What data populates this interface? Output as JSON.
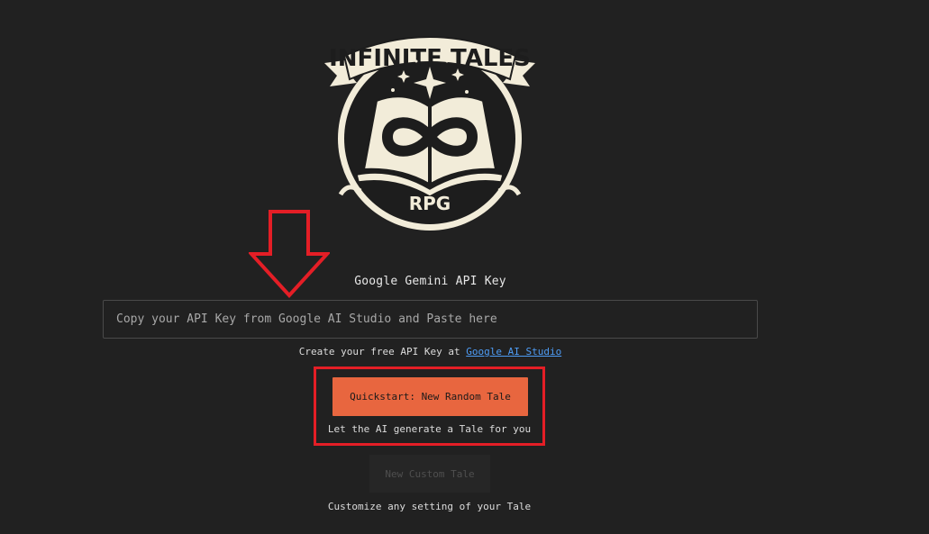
{
  "logo": {
    "title": "INFINITE TALES",
    "subtitle": "RPG"
  },
  "api_key": {
    "label": "Google Gemini API Key",
    "placeholder": "Copy your API Key from Google AI Studio and Paste here",
    "value": "",
    "help_prefix": "Create your free API Key at ",
    "help_link": "Google AI Studio"
  },
  "quickstart": {
    "button_label": "Quickstart: New Random Tale",
    "help": "Let the AI generate a Tale for you"
  },
  "custom": {
    "button_label": "New Custom Tale",
    "help": "Customize any setting of your Tale"
  },
  "colors": {
    "background": "#212121",
    "accent": "#e8663f",
    "link": "#4e9cf5",
    "annotation": "#e41e26"
  }
}
